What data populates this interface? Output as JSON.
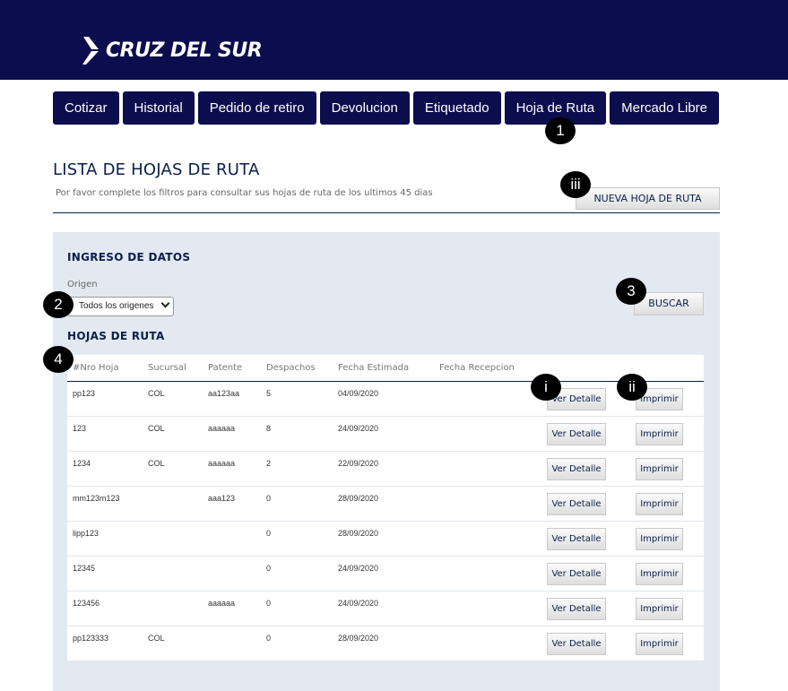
{
  "brand": {
    "name": "CRUZ DEL SUR"
  },
  "nav": {
    "items": [
      {
        "label": "Cotizar"
      },
      {
        "label": "Historial"
      },
      {
        "label": "Pedido de retiro"
      },
      {
        "label": "Devolucion"
      },
      {
        "label": "Etiquetado"
      },
      {
        "label": "Hoja de Ruta"
      },
      {
        "label": "Mercado Libre"
      }
    ]
  },
  "page": {
    "title": "LISTA DE HOJAS DE RUTA",
    "subtitle": "Por favor complete los filtros para consultar sus hojas de ruta de los ultimos 45 dias",
    "new_button": "NUEVA HOJA DE RUTA"
  },
  "form": {
    "section_title": "INGRESO DE DATOS",
    "origen_label": "Origen",
    "origen_value": "Todos los origenes",
    "search_button": "BUSCAR"
  },
  "table": {
    "section_title": "HOJAS DE RUTA",
    "columns": [
      "#Nro Hoja",
      "Sucursal",
      "Patente",
      "Despachos",
      "Fecha Estimada",
      "Fecha Recepcion"
    ],
    "detail_label": "Ver Detalle",
    "print_label": "Imprimir",
    "rows": [
      {
        "nro": "pp123",
        "sucursal": "COL",
        "patente": "aa123aa",
        "despachos": "5",
        "fecha_estimada": "04/09/2020",
        "fecha_recepcion": ""
      },
      {
        "nro": "123",
        "sucursal": "COL",
        "patente": "aaaaaa",
        "despachos": "8",
        "fecha_estimada": "24/09/2020",
        "fecha_recepcion": ""
      },
      {
        "nro": "1234",
        "sucursal": "COL",
        "patente": "aaaaaa",
        "despachos": "2",
        "fecha_estimada": "22/09/2020",
        "fecha_recepcion": ""
      },
      {
        "nro": "mm123m123",
        "sucursal": "",
        "patente": "aaa123",
        "despachos": "0",
        "fecha_estimada": "28/09/2020",
        "fecha_recepcion": ""
      },
      {
        "nro": "lipp123",
        "sucursal": "",
        "patente": "",
        "despachos": "0",
        "fecha_estimada": "28/09/2020",
        "fecha_recepcion": ""
      },
      {
        "nro": "12345",
        "sucursal": "",
        "patente": "",
        "despachos": "0",
        "fecha_estimada": "24/09/2020",
        "fecha_recepcion": ""
      },
      {
        "nro": "123456",
        "sucursal": "",
        "patente": "aaaaaa",
        "despachos": "0",
        "fecha_estimada": "24/09/2020",
        "fecha_recepcion": ""
      },
      {
        "nro": "pp123333",
        "sucursal": "COL",
        "patente": "",
        "despachos": "0",
        "fecha_estimada": "28/09/2020",
        "fecha_recepcion": ""
      }
    ]
  },
  "annotations": {
    "b1": "1",
    "b2": "2",
    "b3": "3",
    "b4": "4",
    "bi": "i",
    "bii": "ii",
    "biii": "iii"
  }
}
